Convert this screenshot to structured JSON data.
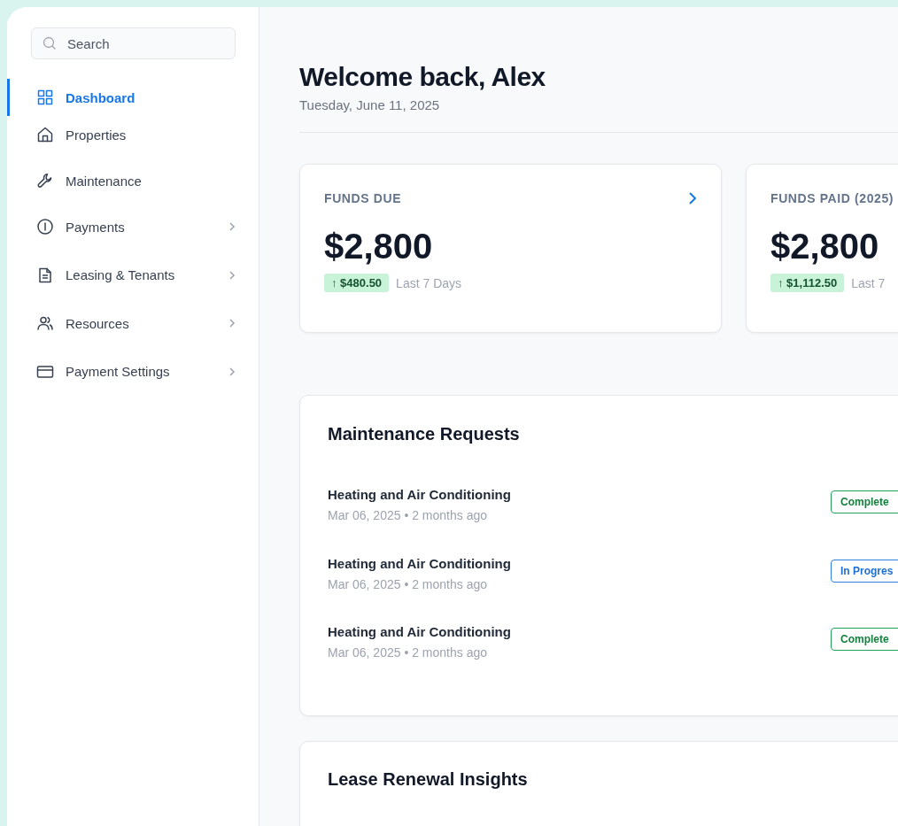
{
  "search": {
    "placeholder": "Search"
  },
  "sidebar": {
    "items": [
      {
        "label": "Dashboard",
        "kind": "grid",
        "selected": true,
        "has_submenu": false
      },
      {
        "label": "Properties",
        "kind": "home",
        "selected": false,
        "has_submenu": false
      },
      {
        "label": "Maintenance",
        "kind": "wrench",
        "selected": false,
        "has_submenu": false
      },
      {
        "label": "Payments",
        "kind": "info",
        "selected": false,
        "has_submenu": true
      },
      {
        "label": "Leasing & Tenants",
        "kind": "document",
        "selected": false,
        "has_submenu": true
      },
      {
        "label": "Resources",
        "kind": "users",
        "selected": false,
        "has_submenu": true
      },
      {
        "label": "Payment Settings",
        "kind": "card",
        "selected": false,
        "has_submenu": true
      }
    ]
  },
  "header": {
    "title": "Welcome back, Alex",
    "date": "Tuesday, June 11, 2025"
  },
  "stat_cards": [
    {
      "label": "FUNDS DUE",
      "amount": "$2,800",
      "change": "↑ $480.50",
      "period": "Last 7 Days",
      "has_link": true
    },
    {
      "label": "FUNDS PAID (2025)",
      "amount": "$2,800",
      "change": "↑ $1,112.50",
      "period": "Last 7",
      "has_link": false
    }
  ],
  "maintenance": {
    "title": "Maintenance Requests",
    "requests": [
      {
        "title": "Heating and Air Conditioning",
        "meta": "Mar 06, 2025 • 2 months ago",
        "status": "Complete",
        "kind": "complete"
      },
      {
        "title": "Heating and Air Conditioning",
        "meta": "Mar 06, 2025 • 2 months ago",
        "status": "In Progres",
        "kind": "progress"
      },
      {
        "title": "Heating and Air Conditioning",
        "meta": "Mar 06, 2025 • 2 months ago",
        "status": "Complete",
        "kind": "complete"
      }
    ]
  },
  "lease_renewal": {
    "title": "Lease Renewal Insights"
  }
}
